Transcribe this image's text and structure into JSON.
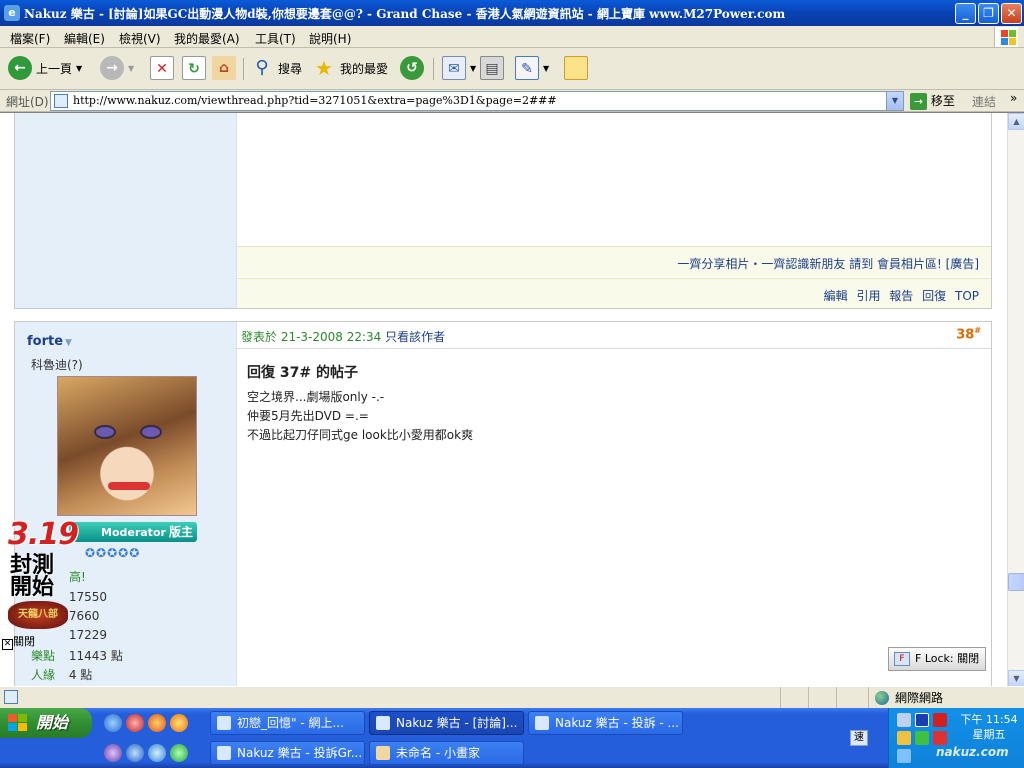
{
  "window": {
    "title": "Nakuz 樂古 - [討論]如果GC出動漫人物d裝,你想要邊套@@? - Grand Chase - 香港人氣網遊資訊站 - 網上寶庫 www.M27Power.com"
  },
  "menu": [
    "檔案(F)",
    "編輯(E)",
    "檢視(V)",
    "我的最愛(A)",
    "工具(T)",
    "說明(H)"
  ],
  "toolbar": {
    "back_label": "上一頁",
    "search_label": "搜尋",
    "favorites_label": "我的最愛"
  },
  "address": {
    "label": "網址(D)",
    "url": "http://www.nakuz.com/viewthread.php?tid=3271051&extra=page%3D1&page=2###",
    "go_label": "移至",
    "links_label": "連結"
  },
  "post1": {
    "ad_text": "一齊分享相片・一齊認識新朋友 請到 會員相片區! [廣告]",
    "actions": [
      "編輯",
      "引用",
      "報告",
      "回復",
      "TOP"
    ]
  },
  "post2": {
    "author": "forte",
    "author_title": "科魯迪(?)",
    "badge_role": "Moderator",
    "badge_label": "版主",
    "high_text": "高!",
    "stats": [
      {
        "key": "",
        "value": "17550"
      },
      {
        "key": "",
        "value": "7660"
      },
      {
        "key": "",
        "value": "17229"
      },
      {
        "key": "樂點",
        "value": "11443 點"
      },
      {
        "key": "人緣",
        "value": "4 點"
      }
    ],
    "meta_prefix": "發表於 21-3-2008 22:34",
    "meta_only": "只看該作者",
    "post_number": "38",
    "post_number_sup": "#",
    "title": "回復 37# 的帖子",
    "body": [
      "空之境界...劇場版only -.-",
      "仲要5月先出DVD =.=",
      "不過比起刀仔同式ge look比小愛用都ok爽"
    ]
  },
  "float_ad": {
    "number": "3.19",
    "text": "封測開始",
    "logo": "天龍八部",
    "close_label": "關閉"
  },
  "flock": {
    "label": "F Lock: 關閉"
  },
  "status": {
    "zone": "網際網路"
  },
  "taskbar": {
    "start_label": "開始",
    "tasks_row1": [
      "初戀_回憶\" - 網上...",
      "Nakuz 樂古 - [討論]...",
      "Nakuz 樂古 - 投訴 - ..."
    ],
    "tasks_row2": [
      "Nakuz 樂古 - 投訴Gr...",
      "未命名 - 小畫家"
    ],
    "lang": "速",
    "clock_time": "下午 11:54",
    "clock_day": "星期五",
    "watermark": "nakuz.com"
  }
}
